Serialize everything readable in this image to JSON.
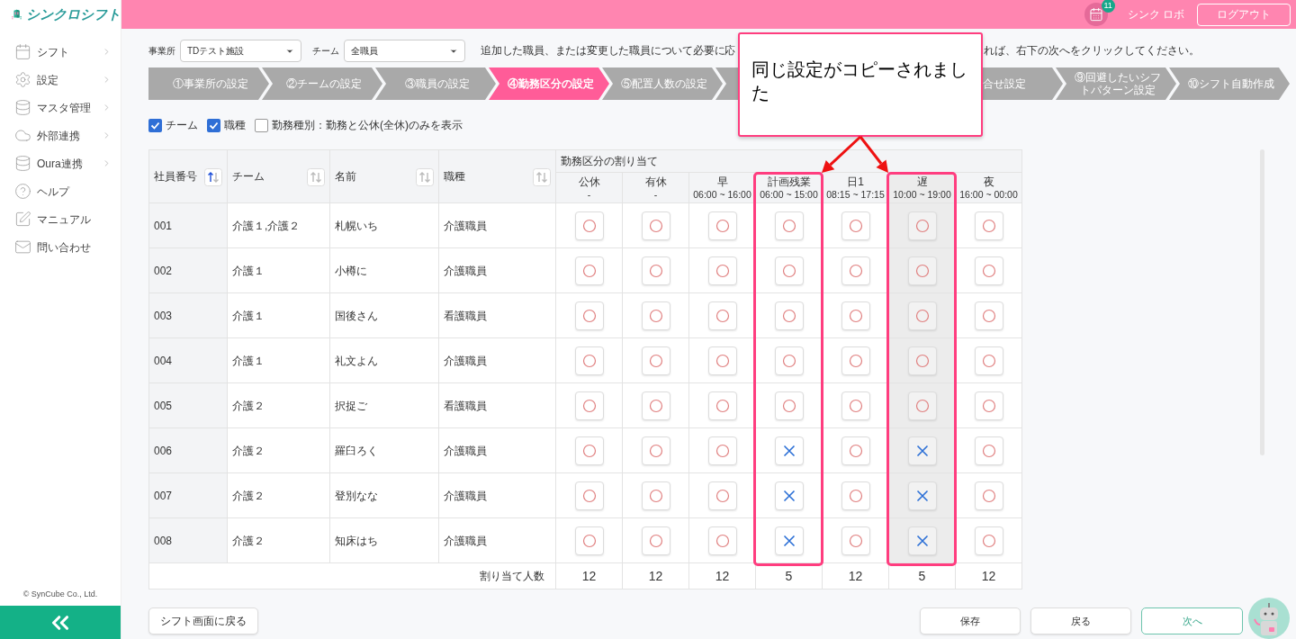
{
  "app": {
    "logo_text": "シンクロシフト"
  },
  "header": {
    "notification_count": "11",
    "user_name": "シンク ロボ",
    "logout": "ログアウト"
  },
  "sidebar": {
    "items": [
      {
        "label": "シフト",
        "has_submenu": true
      },
      {
        "label": "設定",
        "has_submenu": true
      },
      {
        "label": "マスタ管理",
        "has_submenu": true
      },
      {
        "label": "外部連携",
        "has_submenu": true
      },
      {
        "label": "Oura連携",
        "has_submenu": true
      },
      {
        "label": "ヘルプ",
        "has_submenu": false
      },
      {
        "label": "マニュアル",
        "has_submenu": false
      },
      {
        "label": "問い合わせ",
        "has_submenu": false
      }
    ],
    "copyright": "© SynCube Co., Ltd."
  },
  "filters": [
    {
      "label": "事業所",
      "value": "TDテスト施設"
    },
    {
      "label": "チーム",
      "value": "全職員"
    }
  ],
  "instruction": {
    "start": "追加した職員、または変更した職員について必要に応",
    "end": "れば、右下の次へをクリックしてください。"
  },
  "steps": [
    {
      "label": "①事業所の設定",
      "selected": false
    },
    {
      "label": "②チームの設定",
      "selected": false
    },
    {
      "label": "③職員の設定",
      "selected": false
    },
    {
      "label": "④勤務区分の設定",
      "selected": true
    },
    {
      "label": "⑤配置人数の設定",
      "selected": false
    },
    {
      "label": "合せ設定",
      "selected": false,
      "covered_before": true
    },
    {
      "label": "⑨回避したいシフトパターン設定",
      "selected": false
    },
    {
      "label": "⑩シフト自動作成",
      "selected": false
    }
  ],
  "options": [
    {
      "label": "チーム",
      "checked": true
    },
    {
      "label": "職種",
      "checked": true
    },
    {
      "label": "勤務種別：勤務と公休(全休)のみを表示",
      "checked": false
    }
  ],
  "table": {
    "columns": [
      {
        "label": "社員番号",
        "sorted_ascending": true
      },
      {
        "label": "チーム",
        "sorted_ascending": false
      },
      {
        "label": "名前",
        "sorted_ascending": false
      },
      {
        "label": "職種",
        "sorted_ascending": false
      }
    ],
    "group_header": "勤務区分の割り当て",
    "shifts": [
      {
        "name": "公休",
        "time": "-",
        "highlighted": false,
        "shaded": false
      },
      {
        "name": "有休",
        "time": "-",
        "highlighted": false,
        "shaded": false
      },
      {
        "name": "早",
        "time": "06:00 ~ 16:00",
        "highlighted": false,
        "shaded": false
      },
      {
        "name": "計画残業",
        "time": "06:00 ~ 15:00",
        "highlighted": true,
        "shaded": false
      },
      {
        "name": "日1",
        "time": "08:15 ~ 17:15",
        "highlighted": false,
        "shaded": false
      },
      {
        "name": "遅",
        "time": "10:00 ~ 19:00",
        "highlighted": true,
        "shaded": true
      },
      {
        "name": "夜",
        "time": "16:00 ~ 00:00",
        "highlighted": false,
        "shaded": false
      }
    ],
    "rows": [
      {
        "id": "001",
        "team": "介護１,介護２",
        "name": "札幌いち",
        "job": "介護職員",
        "allowed": [
          true,
          true,
          true,
          true,
          true,
          true,
          true
        ]
      },
      {
        "id": "002",
        "team": "介護１",
        "name": "小樽に",
        "job": "介護職員",
        "allowed": [
          true,
          true,
          true,
          true,
          true,
          true,
          true
        ]
      },
      {
        "id": "003",
        "team": "介護１",
        "name": "国後さん",
        "job": "看護職員",
        "allowed": [
          true,
          true,
          true,
          true,
          true,
          true,
          true
        ]
      },
      {
        "id": "004",
        "team": "介護１",
        "name": "礼文よん",
        "job": "介護職員",
        "allowed": [
          true,
          true,
          true,
          true,
          true,
          true,
          true
        ]
      },
      {
        "id": "005",
        "team": "介護２",
        "name": "択捉ご",
        "job": "看護職員",
        "allowed": [
          true,
          true,
          true,
          true,
          true,
          true,
          true
        ]
      },
      {
        "id": "006",
        "team": "介護２",
        "name": "羅臼ろく",
        "job": "介護職員",
        "allowed": [
          true,
          true,
          true,
          false,
          true,
          false,
          true
        ]
      },
      {
        "id": "007",
        "team": "介護２",
        "name": "登別なな",
        "job": "介護職員",
        "allowed": [
          true,
          true,
          true,
          false,
          true,
          false,
          true
        ]
      },
      {
        "id": "008",
        "team": "介護２",
        "name": "知床はち",
        "job": "介護職員",
        "allowed": [
          true,
          true,
          true,
          false,
          true,
          false,
          true
        ]
      }
    ],
    "total_label": "割り当て人数",
    "totals": [
      "12",
      "12",
      "12",
      "5",
      "12",
      "5",
      "12"
    ]
  },
  "callout": {
    "text": "同じ設定がコピーされました"
  },
  "buttons": {
    "back_to_shift": "シフト画面に戻る",
    "save": "保存",
    "back": "戻る",
    "next": "次へ"
  }
}
